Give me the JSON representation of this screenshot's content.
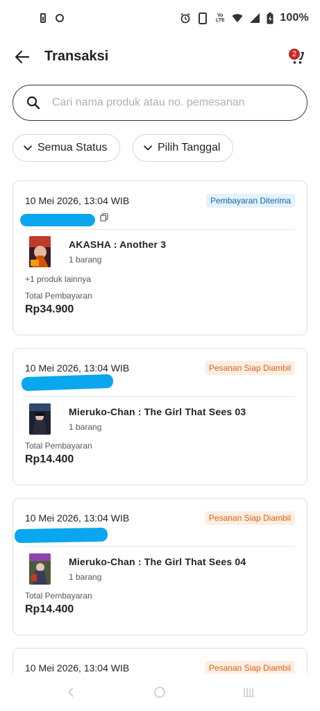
{
  "status_bar": {
    "battery_percent": "100%",
    "volte_line1": "Vo",
    "volte_line2": "LTE"
  },
  "header": {
    "title": "Transaksi",
    "cart_count": "2"
  },
  "search": {
    "placeholder": "Cari nama produk atau no. pemesanan"
  },
  "filters": [
    {
      "label": "Semua Status"
    },
    {
      "label": "Pilih Tanggal"
    }
  ],
  "orders": [
    {
      "date": "10 Mei 2026, 13:04 WIB",
      "status": "Pembayaran Diterima",
      "status_color": "#1565a8",
      "product_name": "AKASHA : Another 3",
      "quantity": "1 barang",
      "more_products": "+1 produk lainnya",
      "total_label": "Total Pembayaran",
      "total": "Rp34.900"
    },
    {
      "date": "10 Mei 2026, 13:04 WIB",
      "status": "Pesanan Siap Diambil",
      "status_color": "#e0620f",
      "product_name": "Mieruko-Chan : The Girl That Sees 03",
      "quantity": "1 barang",
      "total_label": "Total Pembayaran",
      "total": "Rp14.400"
    },
    {
      "date": "10 Mei 2026, 13:04 WIB",
      "status": "Pesanan Siap Diambil",
      "status_color": "#e0620f",
      "product_name": "Mieruko-Chan : The Girl That Sees 04",
      "quantity": "1 barang",
      "total_label": "Total Pembayaran",
      "total": "Rp14.400"
    },
    {
      "date": "10 Mei 2026, 13:04 WIB",
      "status": "Pesanan Siap Diambil",
      "status_color": "#e0620f"
    }
  ],
  "icons": {
    "back": "arrow-left-icon",
    "cart": "cart-icon",
    "search": "search-icon",
    "chevron": "chevron-down-icon",
    "copy": "copy-icon"
  },
  "colors": {
    "accent_red": "#c62828",
    "redaction_blue": "#0aa6ee"
  }
}
